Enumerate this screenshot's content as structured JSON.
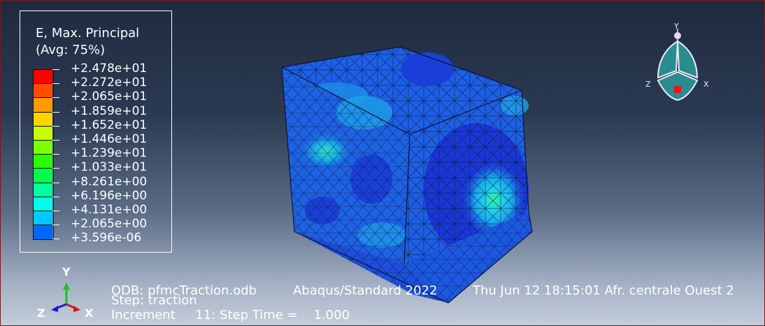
{
  "legend": {
    "title_line1": "E, Max. Principal",
    "title_line2": "(Avg: 75%)",
    "values": [
      "+2.478e+01",
      "+2.272e+01",
      "+2.065e+01",
      "+1.859e+01",
      "+1.652e+01",
      "+1.446e+01",
      "+1.239e+01",
      "+1.033e+01",
      "+8.261e+00",
      "+6.196e+00",
      "+4.131e+00",
      "+2.065e+00",
      "+3.596e-06"
    ],
    "colors": [
      "#ff0000",
      "#ff4d00",
      "#ff9a00",
      "#ffd200",
      "#c8ff00",
      "#7dff00",
      "#2aff00",
      "#00ff4d",
      "#00ffa0",
      "#00ffe8",
      "#00c7ff",
      "#0068ff",
      "#0000ff"
    ]
  },
  "info": {
    "odb": "ODB: pfmcTraction.odb",
    "solver": "Abaqus/Standard 2022",
    "date": "Thu Jun 12 18:15:01 Afr. centrale Ouest 2",
    "step": "Step: traction",
    "increment": "Increment     11: Step Time =    1.000"
  },
  "triad": {
    "y": "Y",
    "z": "Z",
    "x": "X"
  },
  "view_cube": {
    "y": "Y",
    "z": "Z",
    "x": "X"
  }
}
